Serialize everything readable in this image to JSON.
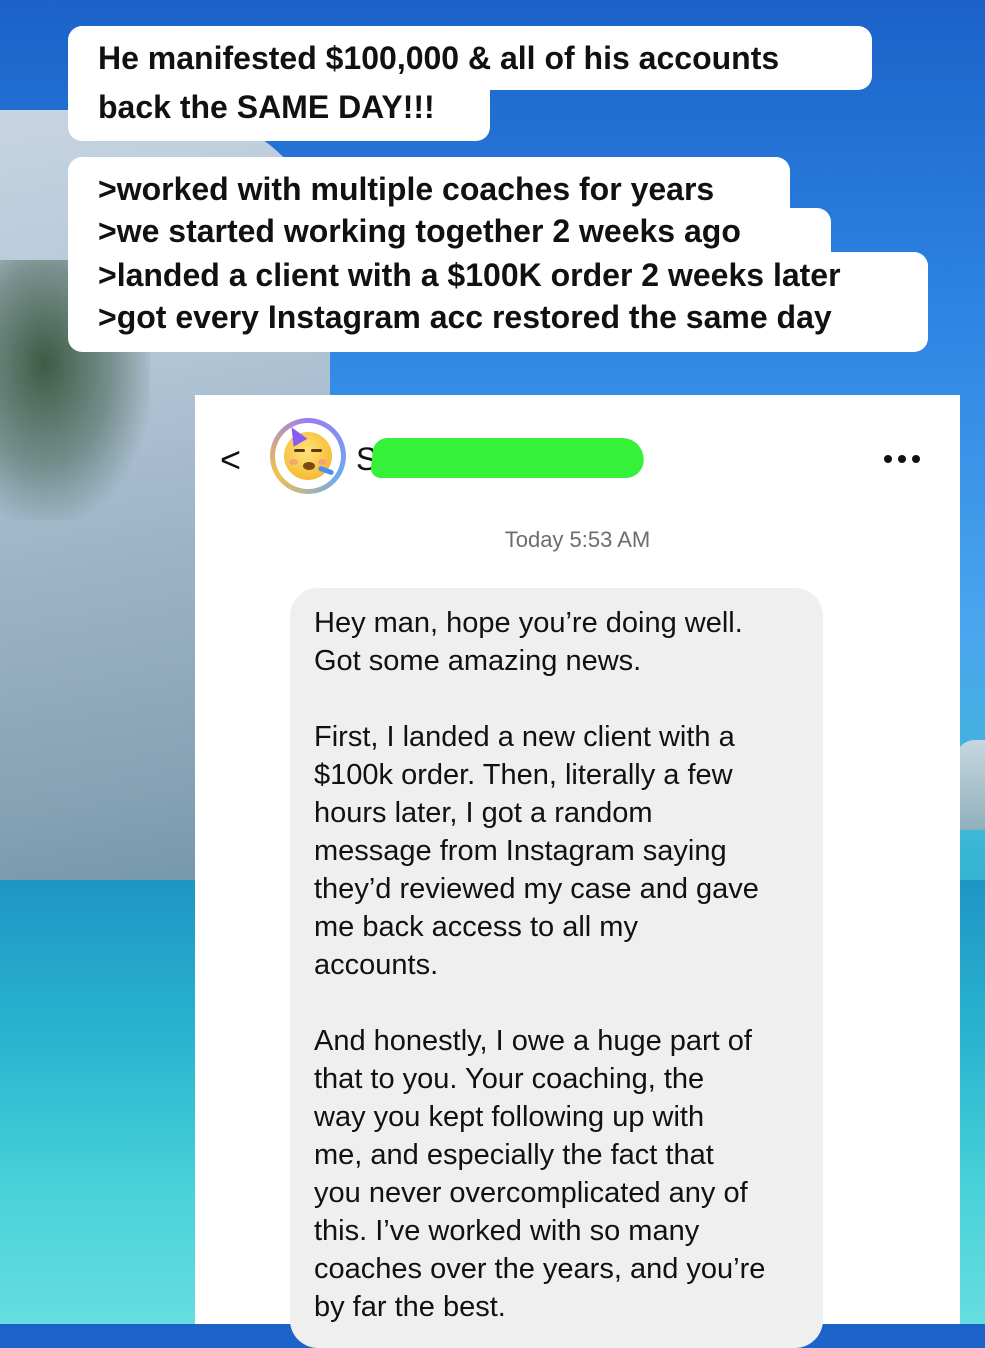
{
  "overlay": {
    "headline": [
      "He manifested $100,000 & all of his accounts",
      "back the SAME DAY!!!"
    ],
    "points": [
      ">worked with multiple coaches for years",
      ">we started working together 2 weeks ago",
      ">landed a client with a $100K order 2 weeks later",
      ">got every Instagram acc restored the same day"
    ]
  },
  "chat": {
    "back_icon": "chevron-left-icon",
    "back_glyph": "<",
    "avatar_icon": "party-face-emoji-icon",
    "contact_initial": "S",
    "more_icon": "more-horizontal-icon",
    "timestamp": "Today 5:53 AM",
    "message_paragraphs": [
      "Hey man, hope you’re doing well.\nGot some amazing news.",
      "First, I landed a new client with a\n$100k order. Then, literally a few\nhours later, I got a random\nmessage from Instagram saying\nthey’d reviewed my case and gave\nme back access to all my\naccounts.",
      "And honestly, I owe a huge part of\nthat to you. Your coaching, the\nway you kept following up with\nme, and especially the fact that\nyou never overcomplicated any of\nthis. I’ve worked with so many\ncoaches over the years, and you’re\nby far the best."
    ]
  },
  "colors": {
    "redaction": "#36f13a",
    "bubble_bg": "#efefef",
    "timestamp_text": "#6d6d6d"
  }
}
